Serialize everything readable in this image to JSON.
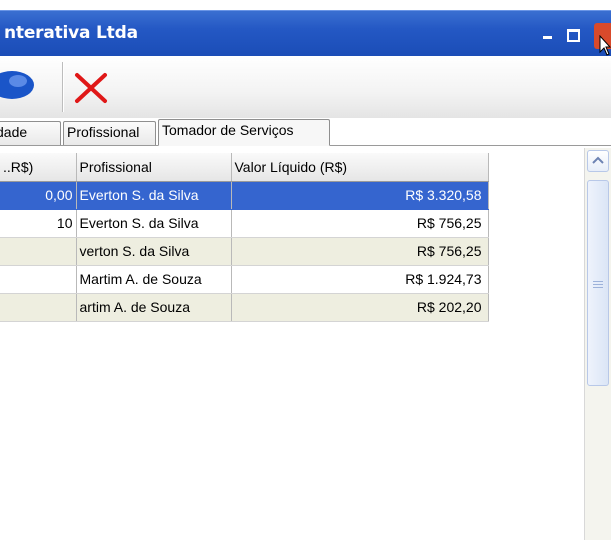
{
  "window": {
    "title": "nterativa Ltda",
    "min_icon": "minimize-icon",
    "max_icon": "maximize-icon",
    "close_icon": "close-icon"
  },
  "toolbar": {
    "items": [
      {
        "icon": "globe-icon",
        "color": "#1a55c8"
      },
      {
        "icon": "x-icon",
        "color": "#e01818"
      }
    ]
  },
  "tabs": [
    {
      "label": "dade"
    },
    {
      "label": "Profissional"
    },
    {
      "label": "Tomador de Serviços",
      "active": true
    }
  ],
  "grid": {
    "columns": [
      "..R$)",
      "Profissional",
      "Valor Líquido (R$)"
    ],
    "rows": [
      {
        "c1": "0,00",
        "profissional": "Everton S. da Silva",
        "valor": "R$ 3.320,58",
        "selected": true
      },
      {
        "c1": "10",
        "profissional": "Everton S. da Silva",
        "valor": "R$ 756,25"
      },
      {
        "c1": "",
        "profissional": "verton S. da Silva",
        "valor": "R$ 756,25"
      },
      {
        "c1": "",
        "profissional": "Martim A. de Souza",
        "valor": "R$ 1.924,73"
      },
      {
        "c1": "",
        "profissional": "artim A. de Souza",
        "valor": "R$ 202,20"
      }
    ]
  },
  "colors": {
    "titlebar": "#2458c4",
    "selection": "#3565cf",
    "row_alt": "#eeeee0"
  }
}
